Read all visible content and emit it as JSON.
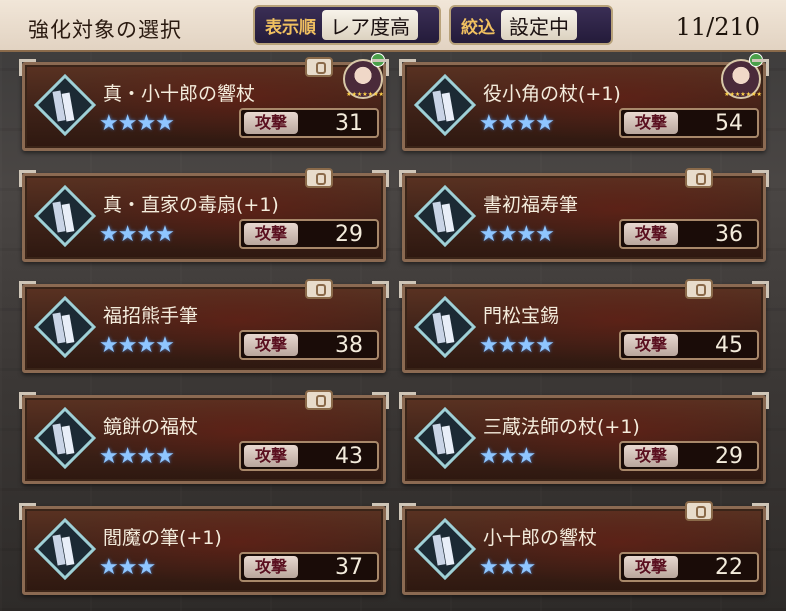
{
  "header": {
    "title": "強化対象の選択",
    "sort_label": "表示順",
    "sort_value": "レア度高",
    "filter_label": "絞込",
    "filter_value": "設定中",
    "count": "11/210"
  },
  "items": [
    {
      "name": "真・小十郎の響杖",
      "stars": "★★★★",
      "stat_label": "攻撃",
      "stat_value": "31",
      "has_avatar": true
    },
    {
      "name": "役小角の杖(+1)",
      "stars": "★★★★",
      "stat_label": "攻撃",
      "stat_value": "54",
      "has_avatar": true
    },
    {
      "name": "真・直家の毒扇(+1)",
      "stars": "★★★★",
      "stat_label": "攻撃",
      "stat_value": "29",
      "has_avatar": false
    },
    {
      "name": "書初福寿筆",
      "stars": "★★★★",
      "stat_label": "攻撃",
      "stat_value": "36",
      "has_avatar": false
    },
    {
      "name": "福招熊手筆",
      "stars": "★★★★",
      "stat_label": "攻撃",
      "stat_value": "38",
      "has_avatar": false
    },
    {
      "name": "門松宝錫",
      "stars": "★★★★",
      "stat_label": "攻撃",
      "stat_value": "45",
      "has_avatar": false
    },
    {
      "name": "鏡餅の福杖",
      "stars": "★★★★",
      "stat_label": "攻撃",
      "stat_value": "43",
      "has_avatar": false
    },
    {
      "name": "三蔵法師の杖(+1)",
      "stars": "★★★",
      "stat_label": "攻撃",
      "stat_value": "29",
      "has_avatar": false
    },
    {
      "name": "閻魔の筆(+1)",
      "stars": "★★★",
      "stat_label": "攻撃",
      "stat_value": "37",
      "has_avatar": false
    },
    {
      "name": "小十郎の響杖",
      "stars": "★★★",
      "stat_label": "攻撃",
      "stat_value": "22",
      "has_avatar": false
    }
  ],
  "colors": {
    "star": "#8fc6ff",
    "card_border": "#8b6a52",
    "header_bg": "#e2d3c2"
  }
}
